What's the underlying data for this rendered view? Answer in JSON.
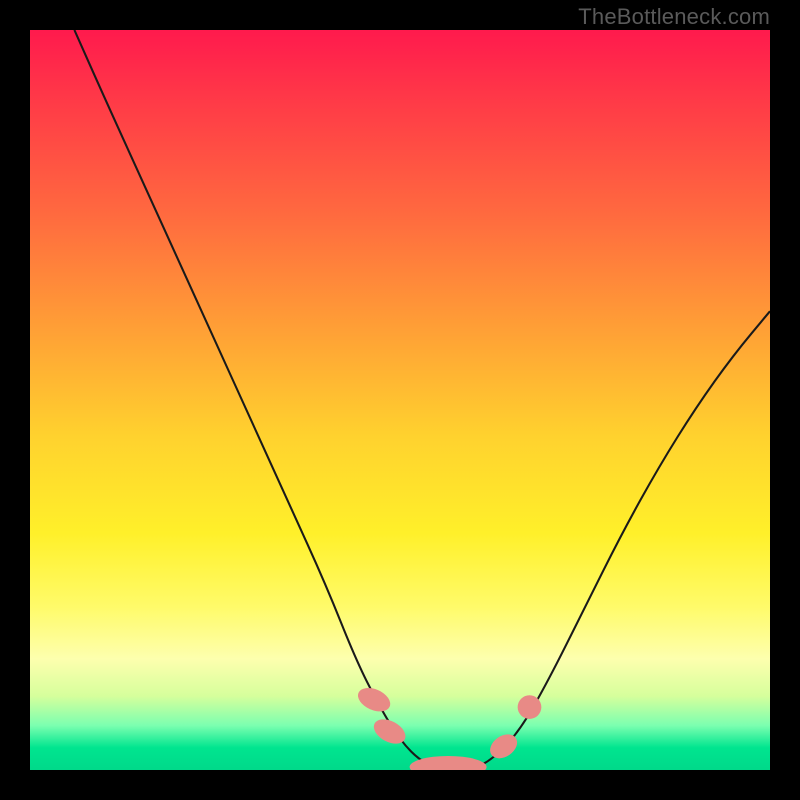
{
  "watermark": "TheBottleneck.com",
  "colors": {
    "curve_stroke": "#1a1a1a",
    "marker_fill": "#e88a86",
    "marker_stroke": "#e88a86"
  },
  "chart_data": {
    "type": "line",
    "title": "",
    "xlabel": "",
    "ylabel": "",
    "xlim": [
      0,
      100
    ],
    "ylim": [
      0,
      100
    ],
    "grid": false,
    "series": [
      {
        "name": "bottleneck-curve",
        "x": [
          6,
          10,
          15,
          20,
          25,
          30,
          35,
          40,
          44,
          47,
          50,
          53,
          56,
          59,
          62,
          66,
          70,
          75,
          80,
          85,
          90,
          95,
          100
        ],
        "y": [
          100,
          91,
          80,
          69,
          58,
          47,
          36,
          25,
          15,
          9,
          4,
          1,
          0,
          0,
          1,
          5,
          12,
          22,
          32,
          41,
          49,
          56,
          62
        ]
      }
    ],
    "markers": [
      {
        "shape": "capsule",
        "cx": 46.5,
        "cy": 9.5,
        "rx": 1.4,
        "ry": 2.3,
        "angle": -66
      },
      {
        "shape": "capsule",
        "cx": 48.6,
        "cy": 5.2,
        "rx": 1.4,
        "ry": 2.3,
        "angle": -62
      },
      {
        "shape": "capsule",
        "cx": 56.5,
        "cy": 0.4,
        "rx": 5.2,
        "ry": 1.5,
        "angle": 0
      },
      {
        "shape": "capsule",
        "cx": 64.0,
        "cy": 3.2,
        "rx": 1.4,
        "ry": 2.0,
        "angle": 55
      },
      {
        "shape": "circle",
        "cx": 67.5,
        "cy": 8.5,
        "r": 1.6
      }
    ]
  }
}
